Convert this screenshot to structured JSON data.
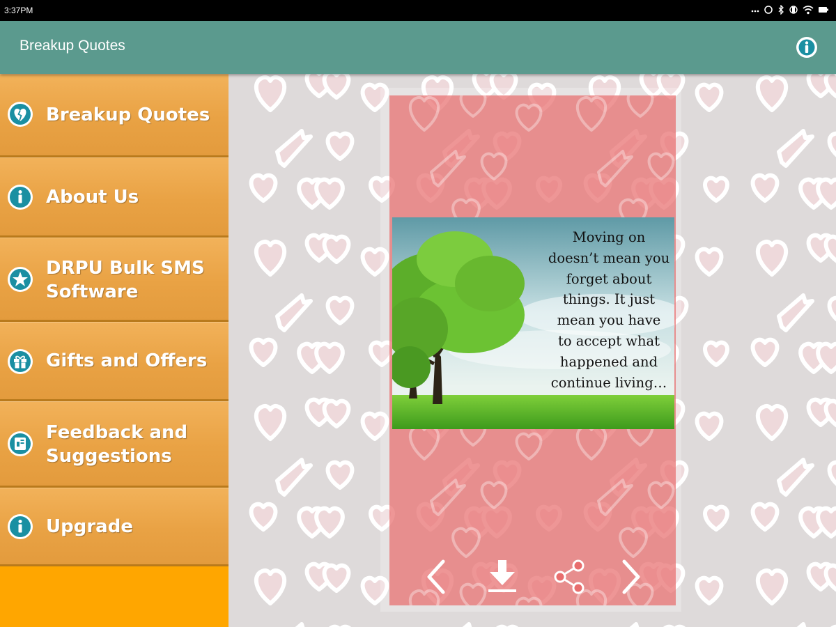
{
  "status_bar": {
    "time": "3:37PM"
  },
  "app_bar": {
    "title": "Breakup Quotes",
    "info_icon": "info-icon"
  },
  "menu": {
    "items": [
      {
        "label": "Breakup Quotes",
        "icon": "broken-heart-icon"
      },
      {
        "label": "About Us",
        "icon": "info-icon"
      },
      {
        "label": "DRPU Bulk SMS Software",
        "icon": "star-icon"
      },
      {
        "label": "Gifts and Offers",
        "icon": "gift-icon"
      },
      {
        "label": "Feedback and Suggestions",
        "icon": "feedback-icon"
      },
      {
        "label": "Upgrade",
        "icon": "info-icon"
      }
    ]
  },
  "quote": {
    "lines": [
      "Moving on",
      "doesn’t mean you",
      "forget about",
      "things. It just",
      "mean you have",
      "to accept what",
      "happened and",
      "continue living…"
    ]
  },
  "controls": [
    "previous-icon",
    "download-icon",
    "share-icon",
    "next-icon"
  ],
  "colors": {
    "app_bar": "#5b9a8e",
    "menu_item": "#e9a244",
    "sidebar_bg": "#ffa600",
    "card": "#e86e6e"
  }
}
